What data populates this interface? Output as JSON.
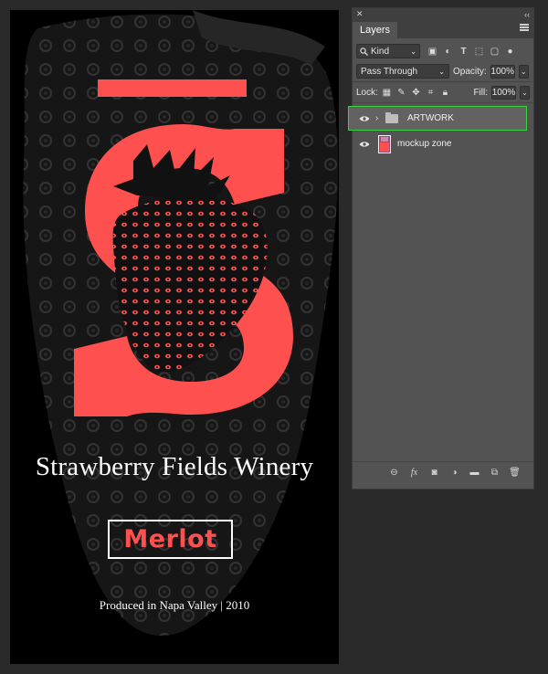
{
  "colors": {
    "app_background": "#2a2a2a",
    "canvas": "#000000",
    "accent_red": "#ff5050",
    "panel": "#535353",
    "selection_outline": "#37d440"
  },
  "artwork": {
    "winery_name": "Strawberry Fields Winery",
    "wine_type": "Merlot",
    "produced_line": "Produced in Napa Valley | 2010"
  },
  "layers_panel": {
    "tab": "Layers",
    "filter": {
      "kind_label": "Kind",
      "icons": [
        "image-filter-icon",
        "adjustment-filter-icon",
        "type-filter-icon",
        "shape-filter-icon",
        "smart-object-filter-icon",
        "filter-toggle-icon"
      ]
    },
    "blend_mode": "Pass Through",
    "opacity_label": "Opacity:",
    "opacity_value": "100%",
    "lock_label": "Lock:",
    "fill_label": "Fill:",
    "fill_value": "100%",
    "layers": [
      {
        "name": "ARTWORK",
        "type": "group",
        "visible": true,
        "selected": true
      },
      {
        "name": "mockup zone",
        "type": "layer",
        "visible": true,
        "selected": false
      }
    ],
    "footer_icons": [
      "link-layers-icon",
      "fx-icon",
      "layer-mask-icon",
      "adjustment-layer-icon",
      "new-group-icon",
      "new-layer-icon",
      "trash-icon"
    ]
  }
}
